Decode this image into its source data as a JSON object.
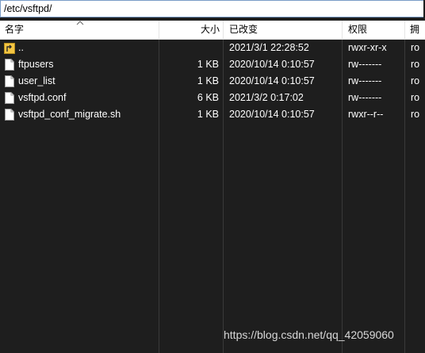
{
  "path": "/etc/vsftpd/",
  "columns": {
    "name": "名字",
    "size": "大小",
    "modified": "已改变",
    "permissions": "权限",
    "owner": "拥"
  },
  "files": [
    {
      "name": "..",
      "size": "",
      "modified": "2021/3/1 22:28:52",
      "permissions": "rwxr-xr-x",
      "owner": "ro",
      "icon": "parent-folder-icon"
    },
    {
      "name": "ftpusers",
      "size": "1 KB",
      "modified": "2020/10/14 0:10:57",
      "permissions": "rw-------",
      "owner": "ro",
      "icon": "file-icon"
    },
    {
      "name": "user_list",
      "size": "1 KB",
      "modified": "2020/10/14 0:10:57",
      "permissions": "rw-------",
      "owner": "ro",
      "icon": "file-icon"
    },
    {
      "name": "vsftpd.conf",
      "size": "6 KB",
      "modified": "2021/3/2 0:17:02",
      "permissions": "rw-------",
      "owner": "ro",
      "icon": "file-icon"
    },
    {
      "name": "vsftpd_conf_migrate.sh",
      "size": "1 KB",
      "modified": "2020/10/14 0:10:57",
      "permissions": "rwxr--r--",
      "owner": "ro",
      "icon": "file-icon"
    }
  ],
  "watermark": "https://blog.csdn.net/qq_42059060",
  "colors": {
    "list_background": "#1e1e1e",
    "header_background": "#ffffff",
    "folder_icon": "#f4c542",
    "text": "#ffffff"
  }
}
